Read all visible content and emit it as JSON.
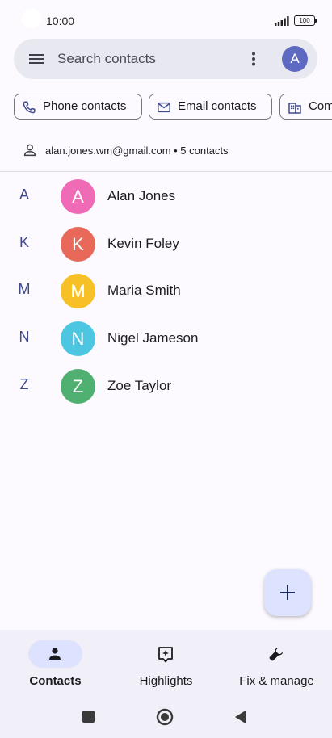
{
  "status_bar": {
    "time": "10:00",
    "battery": "100"
  },
  "search": {
    "placeholder": "Search contacts",
    "avatar_letter": "A"
  },
  "chips": [
    {
      "label": "Phone contacts",
      "icon": "phone-icon"
    },
    {
      "label": "Email contacts",
      "icon": "mail-icon"
    },
    {
      "label": "Com",
      "icon": "building-icon"
    }
  ],
  "account": {
    "text": "alan.jones.wm@gmail.com • 5 contacts"
  },
  "contacts": [
    {
      "section": "A",
      "initial": "A",
      "name": "Alan Jones",
      "color": "#f06bb6"
    },
    {
      "section": "K",
      "initial": "K",
      "name": "Kevin Foley",
      "color": "#e8695a"
    },
    {
      "section": "M",
      "initial": "M",
      "name": "Maria Smith",
      "color": "#f6c026"
    },
    {
      "section": "N",
      "initial": "N",
      "name": "Nigel Jameson",
      "color": "#4dc6e2"
    },
    {
      "section": "Z",
      "initial": "Z",
      "name": "Zoe Taylor",
      "color": "#4fb071"
    }
  ],
  "bottom_nav": {
    "items": [
      {
        "label": "Contacts",
        "icon": "person-icon",
        "active": true
      },
      {
        "label": "Highlights",
        "icon": "highlights-icon",
        "active": false
      },
      {
        "label": "Fix & manage",
        "icon": "wrench-icon",
        "active": false
      }
    ]
  },
  "colors": {
    "accent": "#5e6ac2",
    "fab_background": "#dde3ff",
    "nav_background": "#f1eff8"
  }
}
